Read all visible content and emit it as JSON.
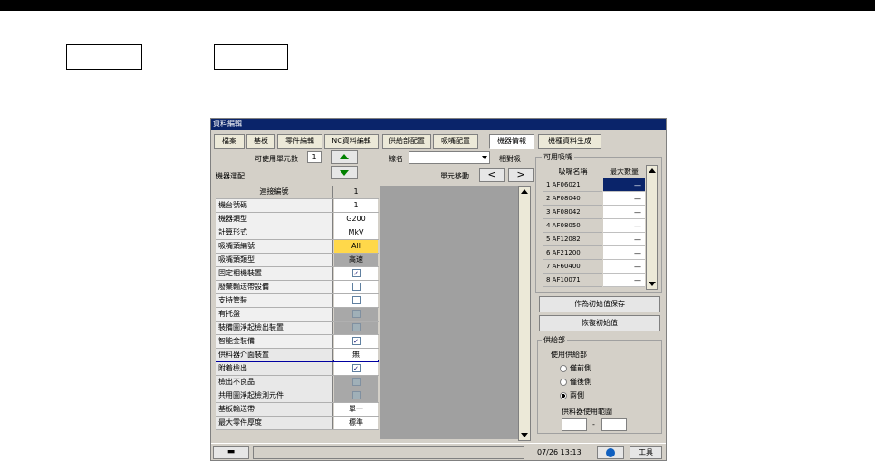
{
  "window": {
    "title": "資料編輯"
  },
  "tabs": [
    {
      "label": "檔案"
    },
    {
      "label": "基板"
    },
    {
      "label": "零件編輯"
    },
    {
      "label": "NC資料編輯"
    },
    {
      "label": "供給部配置"
    },
    {
      "label": "吸嘴配置"
    },
    {
      "label": "機器情報"
    },
    {
      "label": "機種資料生成"
    }
  ],
  "header": {
    "units_label": "可使用單元數",
    "units_value": "1",
    "line_label": "線名",
    "line_value": "",
    "compare_button": "相對吸",
    "machine_config_label": "機器選配",
    "unit_move_label": "單元移動"
  },
  "grid": {
    "header_key": "連接編號",
    "header_value": "1",
    "rows": [
      {
        "k": "機台號碼",
        "v": "1"
      },
      {
        "k": "機器類型",
        "v": "G200"
      },
      {
        "k": "計算形式",
        "v": "MkV"
      },
      {
        "k": "吸嘴頭編號",
        "v": "All"
      },
      {
        "k": "吸嘴頭類型",
        "v": "高速"
      },
      {
        "k": "固定相機裝置",
        "v": "✓"
      },
      {
        "k": "廢棄輸送帶設備",
        "v": ""
      },
      {
        "k": "支持管裝",
        "v": ""
      },
      {
        "k": "有托盤",
        "v": ""
      },
      {
        "k": "裝備圖淨起檢出裝置",
        "v": ""
      },
      {
        "k": "智能金裝備",
        "v": "✓"
      },
      {
        "k": "供料器介面裝置",
        "v": "無"
      },
      {
        "k": "附着檢出",
        "v": "✓"
      },
      {
        "k": "檢出不良品",
        "v": ""
      },
      {
        "k": "共用圖淨起檢測元件",
        "v": ""
      },
      {
        "k": "基板輸送帶",
        "v": "單一"
      },
      {
        "k": "最大零件厚度",
        "v": "標準"
      }
    ]
  },
  "nozzles": {
    "group_label": "可用吸嘴",
    "col_name": "吸嘴名稱",
    "col_max": "最大數量",
    "items": [
      {
        "name": "1 AF06021",
        "max": "—"
      },
      {
        "name": "2 AF08040",
        "max": "—"
      },
      {
        "name": "3 AF08042",
        "max": "—"
      },
      {
        "name": "4 AF08050",
        "max": "—"
      },
      {
        "name": "5 AF12082",
        "max": "—"
      },
      {
        "name": "6 AF21200",
        "max": "—"
      },
      {
        "name": "7 AF60400",
        "max": "—"
      },
      {
        "name": "8 AF10071",
        "max": "—"
      }
    ],
    "save_button": "作為初始值保存",
    "restore_button": "恢復初始值"
  },
  "feeder": {
    "group_label": "供給部",
    "use_label": "使用供給部",
    "options": [
      {
        "label": "僅前側"
      },
      {
        "label": "僅後側"
      },
      {
        "label": "兩側"
      }
    ],
    "selected": "兩側",
    "range_label": "供料器使用範圍",
    "range_sep": "-"
  },
  "statusbar": {
    "datetime": "07/26 13:13",
    "tools_label": "工具"
  }
}
